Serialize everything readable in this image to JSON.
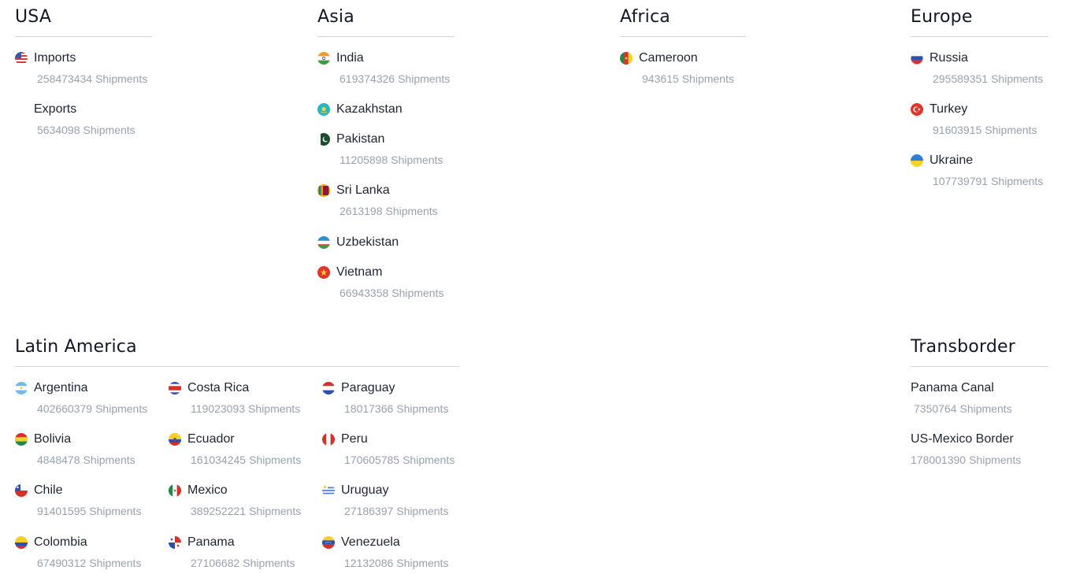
{
  "sections": {
    "usa": {
      "title": "USA",
      "items": [
        {
          "name": "Imports",
          "count": "258473434",
          "unit": "Shipments",
          "flag": "flag-us-icon"
        },
        {
          "name": "Exports",
          "count": "5634098",
          "unit": "Shipments",
          "flag": ""
        }
      ]
    },
    "asia": {
      "title": "Asia",
      "items": [
        {
          "name": "India",
          "count": "619374326",
          "unit": "Shipments",
          "flag": "flag-india-icon"
        },
        {
          "name": "Kazakhstan",
          "count": "",
          "unit": "",
          "flag": "flag-kazakhstan-icon"
        },
        {
          "name": "Pakistan",
          "count": "11205898",
          "unit": "Shipments",
          "flag": "flag-pakistan-icon"
        },
        {
          "name": "Sri Lanka",
          "count": "2613198",
          "unit": "Shipments",
          "flag": "flag-sri-lanka-icon"
        },
        {
          "name": "Uzbekistan",
          "count": "",
          "unit": "",
          "flag": "flag-uzbekistan-icon"
        },
        {
          "name": "Vietnam",
          "count": "66943358",
          "unit": "Shipments",
          "flag": "flag-vietnam-icon"
        }
      ]
    },
    "africa": {
      "title": "Africa",
      "items": [
        {
          "name": "Cameroon",
          "count": "943615",
          "unit": "Shipments",
          "flag": "flag-cameroon-icon"
        }
      ]
    },
    "europe": {
      "title": "Europe",
      "items": [
        {
          "name": "Russia",
          "count": "295589351",
          "unit": "Shipments",
          "flag": "flag-russia-icon"
        },
        {
          "name": "Turkey",
          "count": "91603915",
          "unit": "Shipments",
          "flag": "flag-turkey-icon"
        },
        {
          "name": "Ukraine",
          "count": "107739791",
          "unit": "Shipments",
          "flag": "flag-ukraine-icon"
        }
      ]
    },
    "latin_america": {
      "title": "Latin America",
      "columns": [
        [
          {
            "name": "Argentina",
            "count": "402660379",
            "unit": "Shipments",
            "flag": "flag-argentina-icon"
          },
          {
            "name": "Bolivia",
            "count": "4848478",
            "unit": "Shipments",
            "flag": "flag-bolivia-icon"
          },
          {
            "name": "Chile",
            "count": "91401595",
            "unit": "Shipments",
            "flag": "flag-chile-icon"
          },
          {
            "name": "Colombia",
            "count": "67490312",
            "unit": "Shipments",
            "flag": "flag-colombia-icon"
          }
        ],
        [
          {
            "name": "Costa Rica",
            "count": "119023093",
            "unit": "Shipments",
            "flag": "flag-costa-rica-icon"
          },
          {
            "name": "Ecuador",
            "count": "161034245",
            "unit": "Shipments",
            "flag": "flag-ecuador-icon"
          },
          {
            "name": "Mexico",
            "count": "389252221",
            "unit": "Shipments",
            "flag": "flag-mexico-icon"
          },
          {
            "name": "Panama",
            "count": "27106682",
            "unit": "Shipments",
            "flag": "flag-panama-icon"
          }
        ],
        [
          {
            "name": "Paraguay",
            "count": "18017366",
            "unit": "Shipments",
            "flag": "flag-paraguay-icon"
          },
          {
            "name": "Peru",
            "count": "170605785",
            "unit": "Shipments",
            "flag": "flag-peru-icon"
          },
          {
            "name": "Uruguay",
            "count": "27186397",
            "unit": "Shipments",
            "flag": "flag-uruguay-icon"
          },
          {
            "name": "Venezuela",
            "count": "12132086",
            "unit": "Shipments",
            "flag": "flag-venezuela-icon"
          }
        ]
      ]
    },
    "transborder": {
      "title": "Transborder",
      "items": [
        {
          "name": "Panama Canal",
          "count": "7350764",
          "unit": "Shipments",
          "flag": ""
        },
        {
          "name": "US-Mexico Border",
          "count": "178001390",
          "unit": "Shipments",
          "flag": ""
        }
      ]
    }
  },
  "colors": {
    "text": "#1f2433",
    "muted": "#9aa1ad",
    "rule": "#d3d6dc"
  }
}
